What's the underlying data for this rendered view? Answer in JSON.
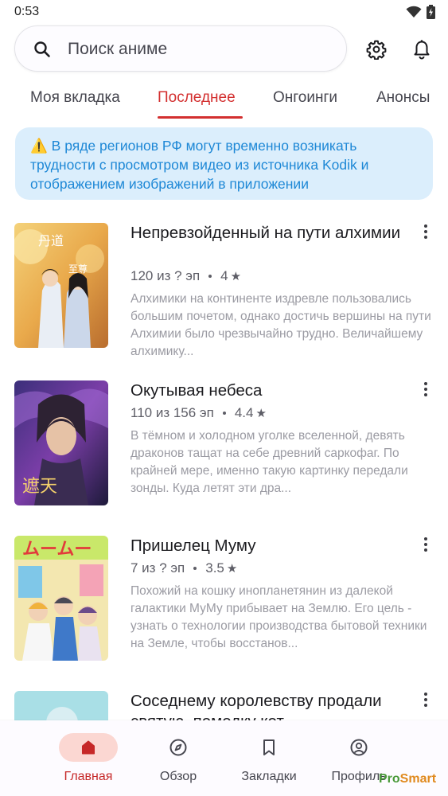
{
  "status_bar": {
    "time": "0:53"
  },
  "search": {
    "placeholder": "Поиск аниме",
    "value": ""
  },
  "header_icons": {
    "settings": "gear-icon",
    "notifications": "bell-icon"
  },
  "tabs": [
    {
      "label": "Моя вкладка",
      "active": false
    },
    {
      "label": "Последнее",
      "active": true
    },
    {
      "label": "Онгоинги",
      "active": false
    },
    {
      "label": "Анонсы",
      "active": false
    }
  ],
  "notice": {
    "icon": "⚠️",
    "text": "В ряде регионов РФ могут временно возникать трудности с просмотром видео из источника Kodik и отображением изображений в приложении"
  },
  "items": [
    {
      "title": "Непревзойденный на пути алхимии",
      "episodes": "120 из ? эп",
      "rating": "4",
      "description": "Алхимики на континенте издревле пользовались большим почетом, однако достичь вершины на пути Алхимии было чрезвычайно трудно. Величайшему алхимику..."
    },
    {
      "title": "Окутывая небеса",
      "episodes": "110 из 156 эп",
      "rating": "4.4",
      "description": "В тёмном и холодном уголке вселенной, девять драконов тащат на себе древний саркофаг. По крайней мере, именно такую картинку передали зонды. Куда летят эти дра..."
    },
    {
      "title": "Пришелец Муму",
      "episodes": "7 из ? эп",
      "rating": "3.5",
      "description": "Похожий на кошку инопланетянин из далекой галактики МуМу прибывает на Землю. Его цель - узнать о технологии производства бытовой техники на Земле, чтобы восстанов..."
    },
    {
      "title": "Соседнему королевству продали святую, помодку кот",
      "episodes": "",
      "rating": "",
      "description": ""
    }
  ],
  "bottom_nav": [
    {
      "label": "Главная",
      "icon": "home-icon",
      "active": true
    },
    {
      "label": "Обзор",
      "icon": "compass-icon",
      "active": false
    },
    {
      "label": "Закладки",
      "icon": "bookmark-icon",
      "active": false
    },
    {
      "label": "Профиль",
      "icon": "profile-icon",
      "active": false
    }
  ],
  "watermark": {
    "part1": "Pro",
    "part2": "Smart"
  },
  "colors": {
    "accent": "#d32f2f",
    "notice_bg": "#dbeefc",
    "notice_text": "#1e88d6",
    "nav_active_pill": "#fbd7d2"
  }
}
